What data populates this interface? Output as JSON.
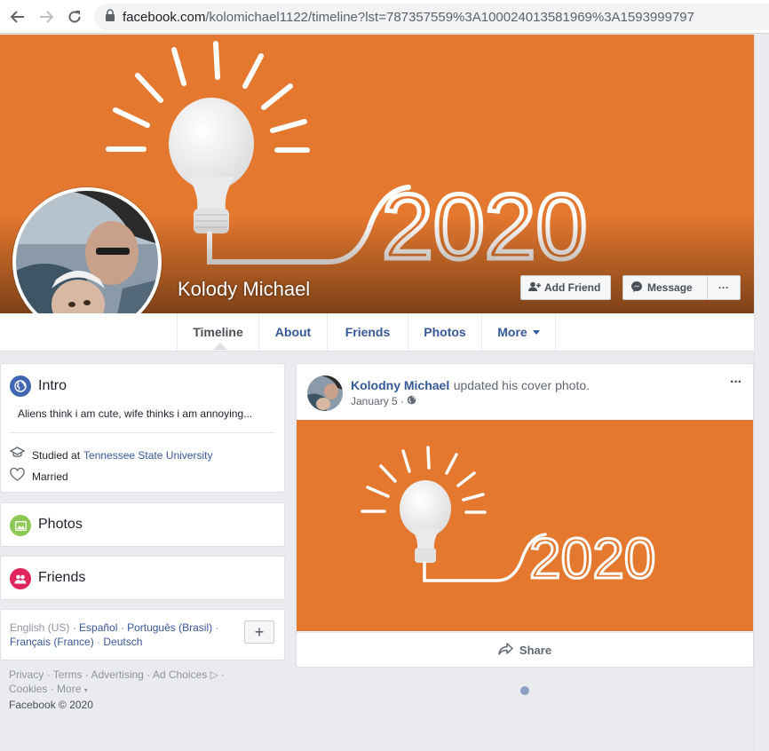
{
  "browser": {
    "url_domain": "facebook.com",
    "url_path": "/kolomichael1122/timeline?lst=787357559%3A100024013581969%3A1593999797"
  },
  "profile": {
    "name": "Kolody Michael",
    "add_friend_label": "Add Friend",
    "message_label": "Message",
    "more_label": "···"
  },
  "cover": {
    "year_text": "2020"
  },
  "tabs": [
    {
      "label": "Timeline"
    },
    {
      "label": "About"
    },
    {
      "label": "Friends"
    },
    {
      "label": "Photos"
    },
    {
      "label": "More"
    }
  ],
  "intro": {
    "title": "Intro",
    "bio": "Aliens think i am cute, wife thinks i am annoying...",
    "studied_prefix": "Studied at",
    "school": "Tennessee State University",
    "relationship": "Married"
  },
  "photos_card": {
    "title": "Photos"
  },
  "friends_card": {
    "title": "Friends"
  },
  "languages": {
    "current": "English (US)",
    "others": [
      "Español",
      "Português (Brasil)",
      "Français (France)",
      "Deutsch"
    ],
    "add_label": "+"
  },
  "footer": {
    "line1": [
      "Privacy",
      "Terms",
      "Advertising",
      "Ad Choices"
    ],
    "line2": [
      "Cookies",
      "More"
    ],
    "copyright": "Facebook © 2020"
  },
  "post": {
    "author": "Kolodny Michael",
    "action": "updated his cover photo.",
    "date": "January 5",
    "menu_label": "···",
    "share_label": "Share",
    "image_year_text": "2020"
  },
  "colors": {
    "cover_orange": "#e4782f",
    "link_blue": "#365899",
    "page_bg": "#e9ebee"
  }
}
